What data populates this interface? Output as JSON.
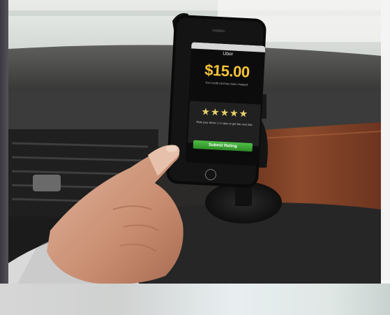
{
  "phone_screen": {
    "app_name": "Uber",
    "carrier": "",
    "price": "$15.00",
    "receipt_note": "Your credit card has been charged",
    "stars": "★★★★★",
    "rating_note": "Rate your driver 1–5 stars to get the next ride",
    "submit_label": "Submit Rating"
  },
  "colors": {
    "price": "#f3c33a",
    "button": "#3aa533",
    "stars": "#e8d16a"
  }
}
